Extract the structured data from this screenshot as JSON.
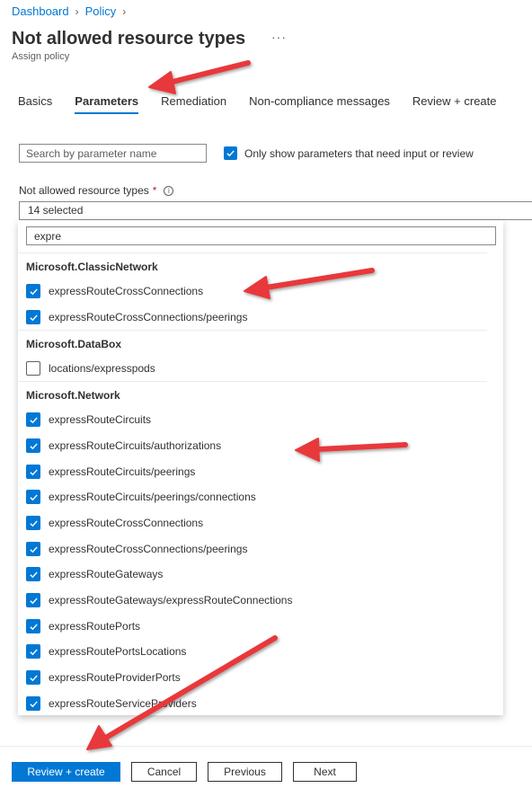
{
  "breadcrumb": {
    "items": [
      "Dashboard",
      "Policy"
    ]
  },
  "page": {
    "title": "Not allowed resource types",
    "subtitle": "Assign policy",
    "more": "···"
  },
  "tabs": [
    {
      "label": "Basics",
      "active": false
    },
    {
      "label": "Parameters",
      "active": true
    },
    {
      "label": "Remediation",
      "active": false
    },
    {
      "label": "Non-compliance messages",
      "active": false
    },
    {
      "label": "Review + create",
      "active": false
    }
  ],
  "search": {
    "placeholder": "Search by parameter name",
    "value": ""
  },
  "only_show": {
    "label": "Only show parameters that need input or review",
    "checked": true
  },
  "param": {
    "label": "Not allowed resource types",
    "required_marker": "*",
    "info_icon": "info-icon",
    "selected_text": "14 selected",
    "filter_value": "expre",
    "groups": [
      {
        "name": "Microsoft.ClassicNetwork",
        "items": [
          {
            "label": "expressRouteCrossConnections",
            "checked": true
          },
          {
            "label": "expressRouteCrossConnections/peerings",
            "checked": true
          }
        ]
      },
      {
        "name": "Microsoft.DataBox",
        "items": [
          {
            "label": "locations/expresspods",
            "checked": false
          }
        ]
      },
      {
        "name": "Microsoft.Network",
        "items": [
          {
            "label": "expressRouteCircuits",
            "checked": true
          },
          {
            "label": "expressRouteCircuits/authorizations",
            "checked": true
          },
          {
            "label": "expressRouteCircuits/peerings",
            "checked": true
          },
          {
            "label": "expressRouteCircuits/peerings/connections",
            "checked": true
          },
          {
            "label": "expressRouteCrossConnections",
            "checked": true
          },
          {
            "label": "expressRouteCrossConnections/peerings",
            "checked": true
          },
          {
            "label": "expressRouteGateways",
            "checked": true
          },
          {
            "label": "expressRouteGateways/expressRouteConnections",
            "checked": true
          },
          {
            "label": "expressRoutePorts",
            "checked": true
          },
          {
            "label": "expressRoutePortsLocations",
            "checked": true
          },
          {
            "label": "expressRouteProviderPorts",
            "checked": true
          },
          {
            "label": "expressRouteServiceProviders",
            "checked": true
          }
        ]
      }
    ]
  },
  "footer": {
    "review_create": "Review + create",
    "cancel": "Cancel",
    "previous": "Previous",
    "next": "Next"
  },
  "colors": {
    "accent": "#0078d4",
    "annotation": "#e8393a"
  }
}
